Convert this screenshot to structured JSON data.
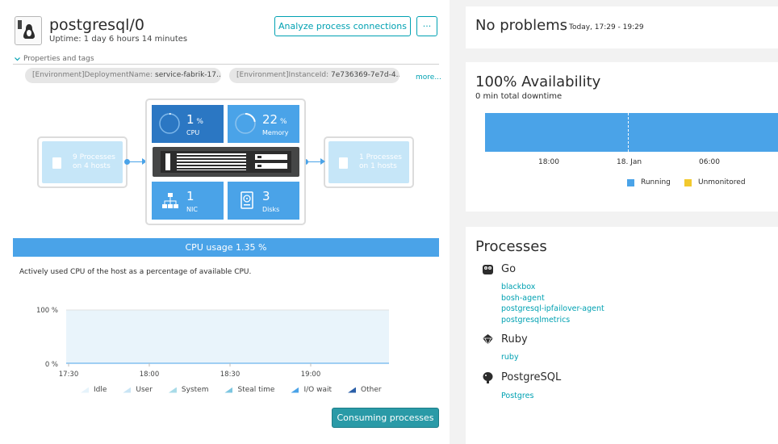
{
  "host": {
    "title": "postgresql/0",
    "uptime": "Uptime: 1 day 6 hours 14 minutes",
    "analyze_label": "Analyze process connections",
    "more_label": "···"
  },
  "properties": {
    "label": "Properties and tags",
    "tags": [
      {
        "key": "[Environment]DeploymentName:",
        "value": "service-fabrik-17..."
      },
      {
        "key": "[Environment]InstanceId:",
        "value": "7e736369-7e7d-4..."
      }
    ],
    "more_link": "more..."
  },
  "diagram": {
    "left_processes": {
      "line1": "9 Processes",
      "line2": "on 4 hosts"
    },
    "right_processes": {
      "line1": "1 Processes",
      "line2": "on 1 hosts"
    },
    "cpu": {
      "value": "1",
      "unit": "%",
      "label": "CPU",
      "fraction": 0.0135
    },
    "memory": {
      "value": "22",
      "unit": "%",
      "label": "Memory",
      "fraction": 0.22
    },
    "nic": {
      "value": "1",
      "label": "NIC"
    },
    "disks": {
      "value": "3",
      "label": "Disks"
    }
  },
  "cpu_section": {
    "bar_label": "CPU usage 1.35 %",
    "description": "Actively used CPU of the host as a percentage of available CPU.",
    "consuming_label": "Consuming processes"
  },
  "chart_data": {
    "type": "area",
    "x_ticks": [
      "17:30",
      "18:00",
      "18:30",
      "19:00"
    ],
    "y_ticks": [
      "100 %",
      "0 %"
    ],
    "ylim": [
      0,
      100
    ],
    "series": [
      {
        "name": "Idle",
        "color": "#e6f3fb"
      },
      {
        "name": "User",
        "color": "#c9e5f5"
      },
      {
        "name": "System",
        "color": "#a8dbe8"
      },
      {
        "name": "Steal time",
        "color": "#7cc6e0"
      },
      {
        "name": "I/O wait",
        "color": "#4aa3e8"
      },
      {
        "name": "Other",
        "color": "#2b5fa8"
      }
    ]
  },
  "problems": {
    "title": "No problems",
    "time": "Today, 17:29 - 19:29"
  },
  "availability": {
    "title": "100% Availability",
    "subtitle": "0 min total downtime",
    "ticks": [
      "18:00",
      "18. Jan",
      "06:00"
    ],
    "legend": [
      {
        "label": "Running",
        "color": "#4aa3e8"
      },
      {
        "label": "Unmonitored",
        "color": "#f2c92e"
      }
    ]
  },
  "processes": {
    "title": "Processes",
    "groups": [
      {
        "name": "Go",
        "items": [
          "blackbox",
          "bosh-agent",
          "postgresql-ipfailover-agent",
          "postgresqlmetrics"
        ]
      },
      {
        "name": "Ruby",
        "items": [
          "ruby"
        ]
      },
      {
        "name": "PostgreSQL",
        "items": [
          "Postgres"
        ]
      }
    ]
  }
}
